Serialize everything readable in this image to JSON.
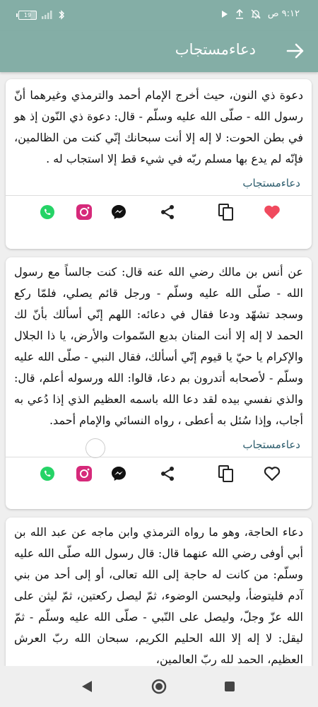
{
  "status": {
    "time": "٩:١٢ ص",
    "battery": "19"
  },
  "appbar": {
    "title": "دعاءمستجاب"
  },
  "cards": [
    {
      "text": "دعوة ذي النون، حيث أخرج الإمام أحمد والترمذي وغيرهما أنّ رسول الله - صلّى الله عليه وسلّم - قال: دعوة ذي النّون إذ هو في بطن الحوت: لا إله إلا أنت سبحانك إنّي كنت من الظالمين، فإنّه لم يدع بها مسلم ربّه في شيء قط إلا استجاب له .",
      "tag": "دعاءمستجاب",
      "favorited": true
    },
    {
      "text": "عن أنس بن مالك رضي الله عنه قال: كنت جالساً مع رسول الله - صلّى الله عليه وسلّم - ورجل قائم يصلي، فلمّا ركع وسجد تشهّد ودعا فقال في دعائه: اللهم إنّي أسألك بأنّ لك الحمد لا إله إلا أنت المنان بديع السّموات والأرض، يا ذا الجلال والإكرام يا حيّ يا قيوم إنّي أسألك، فقال النبي - صلّى الله عليه وسلّم - لأصحابه أتدرون بم دعا، قالوا: الله ورسوله أعلم، قال: والذي نفسي بيده لقد دعا الله باسمه العظيم الذي إذا دُعي به أجاب، وإذا سُئل به أعطى ، رواه النسائي والإمام أحمد.",
      "tag": "دعاءمستجاب",
      "favorited": false
    },
    {
      "text": "دعاء الحاجة، وهو ما رواه الترمذي وابن ماجه عن عبد الله بن أبي أوفى رضي الله عنهما قال: قال رسول الله صلّى الله عليه وسلّم: من كانت له حاجة إلى الله تعالى، أو إلى أحد من بني آدم فليتوضأ، وليحسن الوضوء، ثمّ ليصل ركعتين، ثمّ ليثن على الله عزّ وجلّ، وليصل على النّبي - صلّى الله عليه وسلّم - ثمّ ليقل: لا إله إلا الله الحليم الكريم، سبحان الله ربّ العرش العظيم، الحمد لله ربّ العالمين،"
    }
  ],
  "colors": {
    "accent": "#84aea6",
    "heart": "#f04a5e",
    "whatsapp": "#25d366",
    "instagram": "#d6297a",
    "tag": "#2e5e6e"
  }
}
